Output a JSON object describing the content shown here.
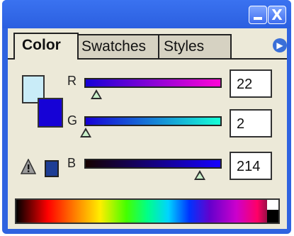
{
  "window": {
    "buttons": {
      "minimize_icon": "minimize-icon",
      "close_icon": "close-icon",
      "close_glyph": "X"
    }
  },
  "tabs": [
    {
      "label": "Color",
      "active": true
    },
    {
      "label": "Swatches",
      "active": false
    },
    {
      "label": "Styles",
      "active": false
    }
  ],
  "panel_menu_glyph": "▶",
  "colors": {
    "foreground": "#1602d6",
    "background": "#c9ecf8",
    "gamut_warning_swatch": "#1e3e95",
    "title_bar": "#2f63e0",
    "panel_bg": "#ece9d8"
  },
  "sliders": [
    {
      "label": "R",
      "value": "22",
      "max": 255
    },
    {
      "label": "G",
      "value": "2",
      "max": 255
    },
    {
      "label": "B",
      "value": "214",
      "max": 255
    }
  ],
  "icons": {
    "gamut_warning": "warning-triangle-icon",
    "panel_menu": "panel-menu-arrow-icon"
  }
}
